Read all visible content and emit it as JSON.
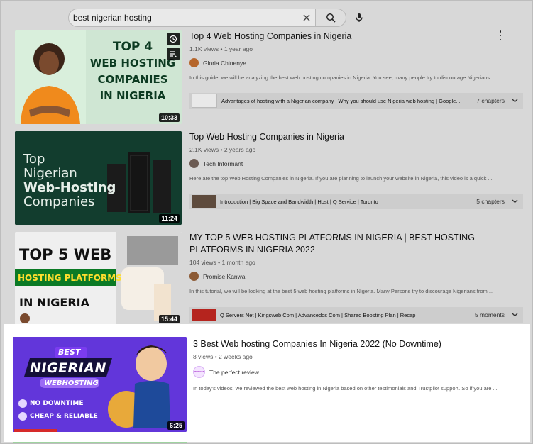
{
  "search": {
    "query": "best nigerian hosting"
  },
  "results": [
    {
      "title": "Top 4 Web Hosting Companies in Nigeria",
      "views": "1.1K views",
      "age": "1 year ago",
      "channel": "Gloria Chinenye",
      "description": "In this guide, we will be analyzing the best web hosting companies in Nigeria. You see, many people try to discourage Nigerians ...",
      "duration": "10:33",
      "thumb_text": [
        "TOP 4",
        "WEB HOSTING",
        "COMPANIES",
        "IN NIGERIA"
      ],
      "chapters_text": "Advantages of hosting with a Nigerian company | Why you should use Nigeria web hosting | Google...",
      "chapters_count": "7 chapters"
    },
    {
      "title": "Top Web Hosting Companies in Nigeria",
      "views": "2.1K views",
      "age": "2 years ago",
      "channel": "Tech Informant",
      "description": "Here are the top Web Hosting Companies in Nigeria. If you are planning to launch your website in Nigeria, this video is a quick ...",
      "duration": "11:24",
      "thumb_text": [
        "Top",
        "Nigerian",
        "Web-Hosting",
        "Companies"
      ],
      "chapters_text": "Introduction | Big Space and Bandwidth | Host | Q Service | Toronto",
      "chapters_count": "5 chapters"
    },
    {
      "title": "MY TOP 5 WEB HOSTING PLATFORMS IN NIGERIA | BEST HOSTING PLATFORMS IN NIGERIA 2022",
      "views": "104 views",
      "age": "1 month ago",
      "channel": "Promise Kanwai",
      "description": "In this tutorial, we will be looking at the best 5 web hosting platforms in Nigeria. Many Persons try to discourage Nigerians from ...",
      "duration": "15:44",
      "thumb_text": [
        "TOP 5 WEB",
        "HOSTING PLATFORMS",
        "IN NIGERIA"
      ],
      "chapters_text": "Q Servers Net | Kingsweb Com | Advancedos Com | Shared Boosting Plan | Recap",
      "chapters_count": "5 moments"
    },
    {
      "title": "3 Best Web hosting Companies In Nigeria 2022 (No Downtime)",
      "views": "8 views",
      "age": "2 weeks ago",
      "channel": "The perfect review",
      "avatar_text": "PERFECT",
      "description": "In today's videos, we reviewed the best web hosting in Nigeria based on other testimonials and Trustpilot support. So if you are ...",
      "duration": "6:25",
      "thumb_text": [
        "BEST",
        "NIGERIAN",
        "WEBHOSTING",
        "NO DOWNTIME",
        "CHEAP & RELIABLE"
      ]
    }
  ],
  "colors": {
    "highlight_bg": "#ffffff",
    "page_dim": "#d8d8d8",
    "purple_thumb": "#5b2bd6",
    "green_thumb": "#cde9d6"
  }
}
